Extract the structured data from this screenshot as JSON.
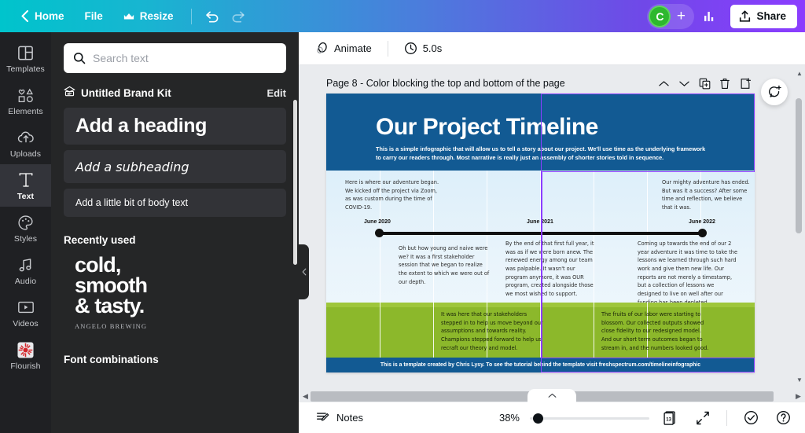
{
  "topbar": {
    "back_label": "Home",
    "file_label": "File",
    "resize_label": "Resize",
    "undo_name": "undo-button",
    "redo_name": "redo-button",
    "avatar_initial": "C",
    "add_people_label": "+",
    "share_label": "Share",
    "brand_gradient_start": "#00c4cc",
    "brand_gradient_end": "#8b3dff"
  },
  "rail": {
    "items": [
      {
        "label": "Templates",
        "icon": "templates-icon",
        "active": false
      },
      {
        "label": "Elements",
        "icon": "elements-icon",
        "active": false
      },
      {
        "label": "Uploads",
        "icon": "uploads-icon",
        "active": false
      },
      {
        "label": "Text",
        "icon": "text-icon",
        "active": true
      },
      {
        "label": "Styles",
        "icon": "styles-icon",
        "active": false
      },
      {
        "label": "Audio",
        "icon": "audio-icon",
        "active": false
      },
      {
        "label": "Videos",
        "icon": "videos-icon",
        "active": false
      },
      {
        "label": "Flourish",
        "icon": "flourish-icon",
        "active": false
      }
    ]
  },
  "panel": {
    "search_placeholder": "Search text",
    "search_value": "",
    "brandkit_title": "Untitled Brand Kit",
    "brandkit_edit": "Edit",
    "card_heading": "Add a heading",
    "card_subheading": "Add a subheading",
    "card_body": "Add a little bit of body text",
    "recently_used_title": "Recently used",
    "recent_line1": "cold,",
    "recent_line2": "smooth",
    "recent_line3": "& tasty.",
    "recent_caption": "ANGELO BREWING",
    "font_combinations_title": "Font combinations"
  },
  "animbar": {
    "animate_label": "Animate",
    "duration_label": "5.0s"
  },
  "page": {
    "title": "Page 8 - Color blocking the top and bottom of the page",
    "tools": [
      "move-up",
      "move-down",
      "duplicate",
      "delete",
      "add-page"
    ],
    "next_page_title": ""
  },
  "infographic": {
    "header_color": "#125a93",
    "band_color": "#9ec63b",
    "title": "Our Project Timeline",
    "subtitle": "This is a simple infographic that will allow us to tell a story about our project.  We'll use time as the underlying framework to carry our readers through.  Most narrative is really just an assembly of shorter stories told in sequence.",
    "block_top_left": "Here is  where our adventure began.  We kicked off the project via Zoom, as was custom during the time of COVID-19.",
    "block_top_right": "Our mighty adventure has ended.  But was it a success? After some time and reflection, we believe that it was.",
    "date_start": "June 2020",
    "date_mid": "June 2021",
    "date_end": "June 2022",
    "block_mid_1": "Oh  but how young and naive were we?  It was a first stakeholder session that we began to realize the extent to which we were out of our depth.",
    "block_mid_2": "By the end of that first full year, it was as if we were born anew.  The renewed energy among our team was palpable.  It wasn't our program anymore, it was OUR program, created alongside those we most wished to support.",
    "block_mid_3": "Coming up towards the end of our 2 year adventure it was time to take the lessons we learned through such hard work and give them new life.  Our reports are not merely a timestamp, but a collection of lessons we designed to live on well after our funding has been depleted.",
    "block_bottom_1": "It was here that our stakeholders stepped in to help us move beyond our assumptions and towards reality. Champions stepped forward to help us recraft our theory and model.",
    "block_bottom_2": "The fruits of our labor were starting to blossom.  Our collected outputs showed close fidelity to our redesigned model. And our short term outcomes began to stream in, and the numbers looked good.",
    "footer": "This is a template created by Chris Lysy.  To see the tutorial behind the template visit freshspectrum.com/timelineinfographic"
  },
  "bottombar": {
    "notes_label": "Notes",
    "zoom_percent": "38%",
    "page_count_badge": "13",
    "fullscreen_name": "fullscreen-button",
    "help_name": "help-button",
    "check_name": "checkmark-button"
  }
}
